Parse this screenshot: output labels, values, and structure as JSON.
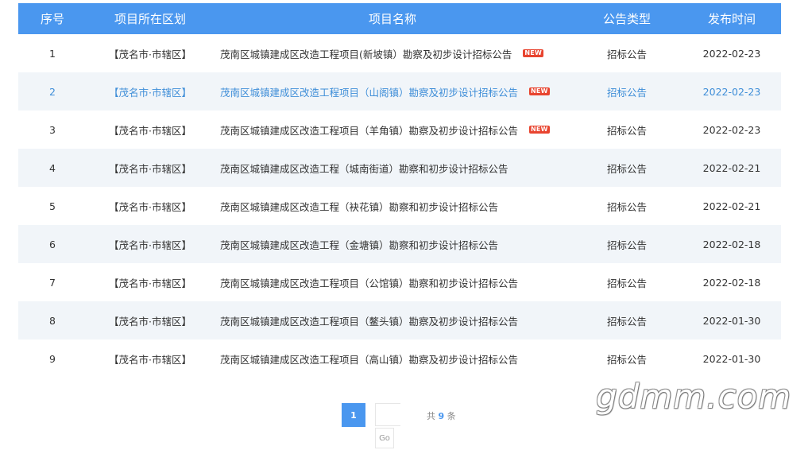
{
  "table": {
    "headers": [
      "序号",
      "项目所在区划",
      "项目名称",
      "公告类型",
      "发布时间"
    ],
    "rows": [
      {
        "no": "1",
        "region": "【茂名市·市辖区】",
        "name": "茂南区城镇建成区改造工程项目(新坡镇）勘察及初步设计招标公告",
        "is_new": true,
        "new_label": "NEW",
        "type": "招标公告",
        "date": "2022-02-23",
        "hover": false
      },
      {
        "no": "2",
        "region": "【茂名市·市辖区】",
        "name": "茂南区城镇建成区改造工程项目（山阁镇）勘察及初步设计招标公告",
        "is_new": true,
        "new_label": "NEW",
        "type": "招标公告",
        "date": "2022-02-23",
        "hover": true
      },
      {
        "no": "3",
        "region": "【茂名市·市辖区】",
        "name": "茂南区城镇建成区改造工程项目（羊角镇）勘察及初步设计招标公告",
        "is_new": true,
        "new_label": "NEW",
        "type": "招标公告",
        "date": "2022-02-23",
        "hover": false
      },
      {
        "no": "4",
        "region": "【茂名市·市辖区】",
        "name": "茂南区城镇建成区改造工程（城南街道）勘察和初步设计招标公告",
        "is_new": false,
        "type": "招标公告",
        "date": "2022-02-21",
        "hover": false
      },
      {
        "no": "5",
        "region": "【茂名市·市辖区】",
        "name": "茂南区城镇建成区改造工程（袂花镇）勘察和初步设计招标公告",
        "is_new": false,
        "type": "招标公告",
        "date": "2022-02-21",
        "hover": false
      },
      {
        "no": "6",
        "region": "【茂名市·市辖区】",
        "name": "茂南区城镇建成区改造工程（金塘镇）勘察和初步设计招标公告",
        "is_new": false,
        "type": "招标公告",
        "date": "2022-02-18",
        "hover": false
      },
      {
        "no": "7",
        "region": "【茂名市·市辖区】",
        "name": "茂南区城镇建成区改造工程项目（公馆镇）勘察和初步设计招标公告",
        "is_new": false,
        "type": "招标公告",
        "date": "2022-02-18",
        "hover": false
      },
      {
        "no": "8",
        "region": "【茂名市·市辖区】",
        "name": "茂南区城镇建成区改造工程项目（鳌头镇）勘察及初步设计招标公告",
        "is_new": false,
        "type": "招标公告",
        "date": "2022-01-30",
        "hover": false
      },
      {
        "no": "9",
        "region": "【茂名市·市辖区】",
        "name": "茂南区城镇建成区改造工程项目（高山镇）勘察及初步设计招标公告",
        "is_new": false,
        "type": "招标公告",
        "date": "2022-01-30",
        "hover": false
      }
    ]
  },
  "pagination": {
    "current_page": "1",
    "total_prefix": "共",
    "total_count": "9",
    "total_suffix": "条",
    "go_label": "Go",
    "page_input_value": ""
  },
  "watermark": "gdmm.com",
  "colors": {
    "header_bg": "#4a97ef",
    "alt_row_bg": "#f1f5f9",
    "hover_text": "#3f8ed8",
    "new_badge": "#e8442f"
  }
}
